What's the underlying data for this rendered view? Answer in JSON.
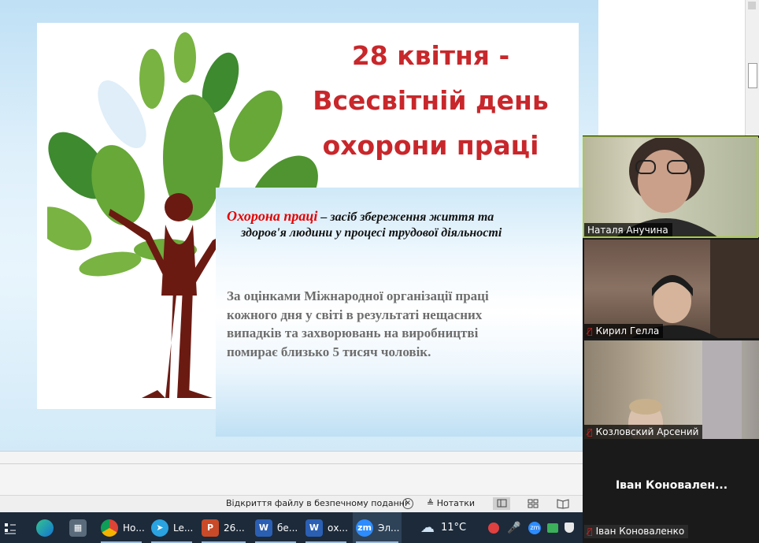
{
  "slide": {
    "title_lines": [
      "28 квітня -",
      "Всесвітній день",
      "охорони праці"
    ],
    "textbox": {
      "term": "Охорона  праці",
      "definition_part1": " – засіб збереження життя та",
      "definition_part2": "здоров'я людини у процесі трудової діяльності",
      "paragraph_lines": [
        "За оцінками  Міжнародної  організації  праці",
        "кожного  дня  у  світі  в результаті  нещасних",
        "випадків  та захворювань  на виробництві",
        "помирає      близько  5  тисяч  чоловік."
      ]
    }
  },
  "statusbar": {
    "protected_view": "Відкриття файлу в безпечному поданні",
    "notes_label": "Нотатки"
  },
  "participants": [
    {
      "name": "Наталя Анучина",
      "muted": false
    },
    {
      "name": "Кирил Гелла",
      "muted": true
    },
    {
      "name": "Козловский Арсений",
      "muted": true
    },
    {
      "name": "Іван Коноваленко",
      "muted": true,
      "display_name": "Іван  Коновален..."
    }
  ],
  "taskbar": {
    "apps": [
      {
        "icon": "edge-icon",
        "label": ""
      },
      {
        "icon": "calculator-icon",
        "label": ""
      },
      {
        "icon": "chrome-icon",
        "label": "Но..."
      },
      {
        "icon": "telegram-icon",
        "label": "Le..."
      },
      {
        "icon": "powerpoint-icon",
        "label": "26..."
      },
      {
        "icon": "word-icon",
        "label": "бе..."
      },
      {
        "icon": "word-icon",
        "label": "ох..."
      },
      {
        "icon": "zoom-icon",
        "label": "Эл..."
      }
    ],
    "weather": "11°C",
    "colors": {
      "bg": "#1c2a3a",
      "accent": "#9bb8d8"
    }
  }
}
